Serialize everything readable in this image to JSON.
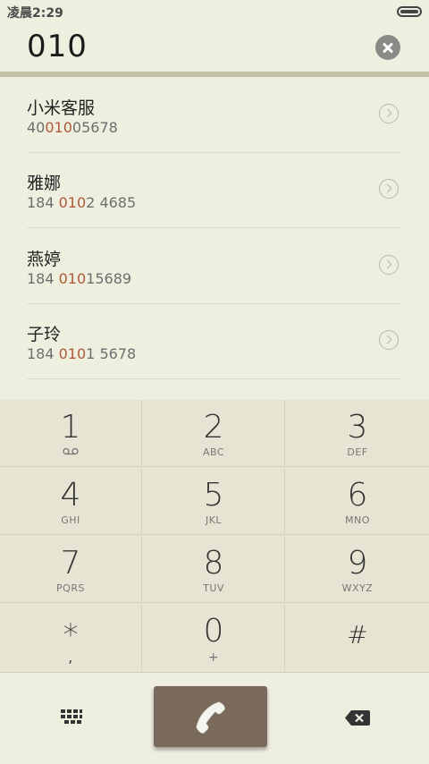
{
  "status_bar": {
    "time": "凌晨2:29"
  },
  "dial_input": {
    "value": "010"
  },
  "contacts": [
    {
      "name": "小米客服",
      "number_pre": "40",
      "number_match": "010",
      "number_post": "05678"
    },
    {
      "name": "雅娜",
      "number_pre": "184 ",
      "number_match": "010",
      "number_post": "2 4685"
    },
    {
      "name": "燕婷",
      "number_pre": "184 ",
      "number_match": "010",
      "number_post": "15689"
    },
    {
      "name": "子玲",
      "number_pre": "184 ",
      "number_match": "010",
      "number_post": "1 5678"
    }
  ],
  "keypad": [
    {
      "digit": "1",
      "letters": ""
    },
    {
      "digit": "2",
      "letters": "ABC"
    },
    {
      "digit": "3",
      "letters": "DEF"
    },
    {
      "digit": "4",
      "letters": "GHI"
    },
    {
      "digit": "5",
      "letters": "JKL"
    },
    {
      "digit": "6",
      "letters": "MNO"
    },
    {
      "digit": "7",
      "letters": "PQRS"
    },
    {
      "digit": "8",
      "letters": "TUV"
    },
    {
      "digit": "9",
      "letters": "WXYZ"
    },
    {
      "digit": "*",
      "letters": ","
    },
    {
      "digit": "0",
      "letters": "+"
    },
    {
      "digit": "#",
      "letters": ""
    }
  ],
  "colors": {
    "background": "#efefe0",
    "call_button": "#7a6a5b",
    "match_highlight": "#b0583a"
  }
}
